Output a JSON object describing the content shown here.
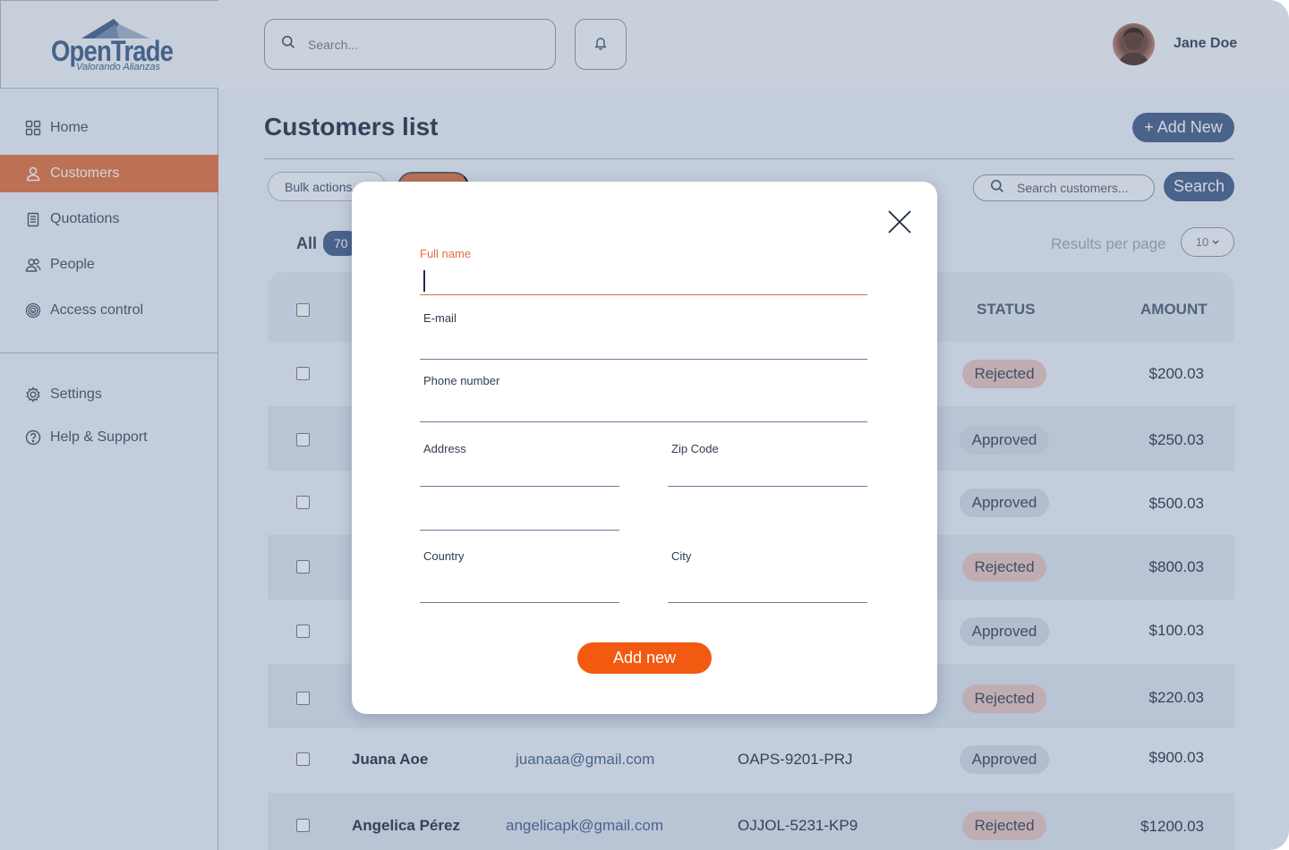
{
  "brand": {
    "name": "OpenTrade",
    "tagline": "Valorando Alianzas",
    "color": "#3e5b87",
    "accent": "#e26f3a"
  },
  "topbar": {
    "search_placeholder": "Search...",
    "user_name": "Jane Doe",
    "bell_icon": "bell-icon"
  },
  "sidebar": {
    "items": [
      {
        "label": "Home",
        "icon": "grid-icon",
        "active": false
      },
      {
        "label": "Customers",
        "icon": "user-icon",
        "active": true
      },
      {
        "label": "Quotations",
        "icon": "document-icon",
        "active": false
      },
      {
        "label": "People",
        "icon": "people-icon",
        "active": false
      },
      {
        "label": "Access control",
        "icon": "fingerprint-icon",
        "active": false
      }
    ],
    "bottom_items": [
      {
        "label": "Settings",
        "icon": "gear-icon"
      },
      {
        "label": "Help & Support",
        "icon": "help-icon"
      }
    ]
  },
  "main": {
    "title": "Customers list",
    "add_new_label": "+ Add New",
    "bulk_actions_label": "Bulk actions",
    "search_placeholder": "Search customers...",
    "search_button": "Search",
    "all_label": "All",
    "all_count": "70",
    "results_per_page_label": "Results per page",
    "results_per_page_value": "10"
  },
  "table": {
    "headers": {
      "status": "STATUS",
      "amount": "AMOUNT"
    },
    "rows": [
      {
        "name": "",
        "email": "",
        "code": "",
        "status": "Rejected",
        "amount": "$200.03"
      },
      {
        "name": "",
        "email": "",
        "code": "",
        "status": "Approved",
        "amount": "$250.03"
      },
      {
        "name": "",
        "email": "",
        "code": "",
        "status": "Approved",
        "amount": "$500.03"
      },
      {
        "name": "",
        "email": "",
        "code": "",
        "status": "Rejected",
        "amount": "$800.03"
      },
      {
        "name": "",
        "email": "",
        "code": "",
        "status": "Approved",
        "amount": "$100.03"
      },
      {
        "name": "",
        "email": "",
        "code": "",
        "status": "Rejected",
        "amount": "$220.03"
      },
      {
        "name": "Juana Aoe",
        "email": "juanaaa@gmail.com",
        "code": "OAPS-9201-PRJ",
        "status": "Approved",
        "amount": "$900.03"
      },
      {
        "name": "Angelica Pérez",
        "email": "angelicapk@gmail.com",
        "code": "OJJOL-5231-KP9",
        "status": "Rejected",
        "amount": "$1200.03"
      }
    ]
  },
  "modal": {
    "fields": {
      "full_name": {
        "label": "Full name",
        "value": ""
      },
      "email": {
        "label": "E-mail",
        "value": ""
      },
      "phone": {
        "label": "Phone number",
        "value": ""
      },
      "address": {
        "label": "Address",
        "value": ""
      },
      "address2": {
        "label": "",
        "value": ""
      },
      "zip": {
        "label": "Zip Code",
        "value": ""
      },
      "country": {
        "label": "Country",
        "value": ""
      },
      "city": {
        "label": "City",
        "value": ""
      }
    },
    "submit_label": "Add new",
    "close_icon": "close-icon"
  }
}
